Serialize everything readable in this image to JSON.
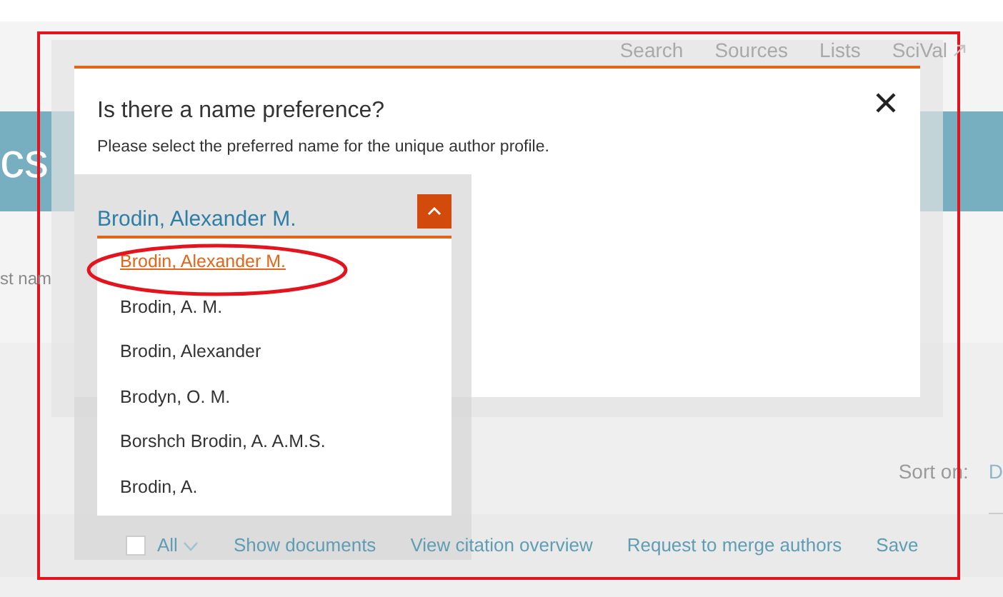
{
  "page": {
    "nav": [
      "Search",
      "Sources",
      "Lists",
      "SciVal"
    ],
    "banner_text": "cs",
    "field_hint": "st nam",
    "sort": {
      "label": "Sort on:",
      "value": "D"
    },
    "toolbar": {
      "select_all": {
        "label": "All",
        "checked": false
      },
      "actions": [
        "Show documents",
        "View citation overview",
        "Request to merge authors",
        "Save"
      ]
    }
  },
  "dialog": {
    "title": "Is there a name preference?",
    "subtitle": "Please select the preferred name for the unique author profile.",
    "name_select": {
      "value": "Brodin, Alexander M.",
      "expanded": true,
      "options": [
        {
          "label": "Brodin, Alexander M.",
          "selected": true
        },
        {
          "label": "Brodin, A. M.",
          "selected": false
        },
        {
          "label": "Brodin, Alexander",
          "selected": false
        },
        {
          "label": "Brodyn, O. M.",
          "selected": false
        },
        {
          "label": "Borshch Brodin, A. A.M.S.",
          "selected": false
        },
        {
          "label": "Brodin, A.",
          "selected": false
        }
      ]
    }
  }
}
